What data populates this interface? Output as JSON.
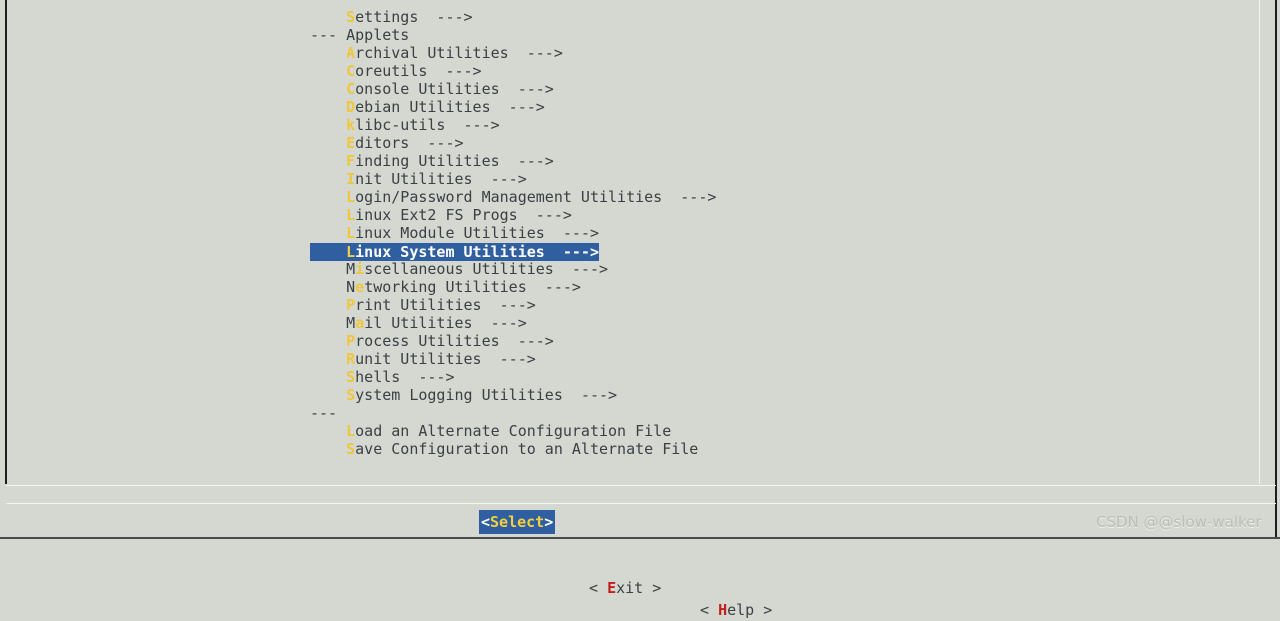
{
  "app": {
    "kind": "ncurses-menuconfig",
    "background_color": "#d4d8d0",
    "text_color": "#3b4044",
    "hotkey_color": "#f0c63c",
    "highlight_bg": "#2f5fa0",
    "highlight_fg": "#ffffff",
    "button_accent_color": "#c0201c"
  },
  "menu": {
    "items": [
      {
        "indent": 4,
        "hot_index": 0,
        "label": "Settings  --->",
        "selected": false,
        "type": "submenu"
      },
      {
        "indent": 0,
        "hot_index": -1,
        "label": "--- Applets",
        "selected": false,
        "type": "separator-label"
      },
      {
        "indent": 4,
        "hot_index": 0,
        "label": "Archival Utilities  --->",
        "selected": false,
        "type": "submenu"
      },
      {
        "indent": 4,
        "hot_index": 0,
        "label": "Coreutils  --->",
        "selected": false,
        "type": "submenu"
      },
      {
        "indent": 4,
        "hot_index": 0,
        "label": "Console Utilities  --->",
        "selected": false,
        "type": "submenu"
      },
      {
        "indent": 4,
        "hot_index": 0,
        "label": "Debian Utilities  --->",
        "selected": false,
        "type": "submenu"
      },
      {
        "indent": 4,
        "hot_index": 0,
        "label": "klibc-utils  --->",
        "selected": false,
        "type": "submenu"
      },
      {
        "indent": 4,
        "hot_index": 0,
        "label": "Editors  --->",
        "selected": false,
        "type": "submenu"
      },
      {
        "indent": 4,
        "hot_index": 0,
        "label": "Finding Utilities  --->",
        "selected": false,
        "type": "submenu"
      },
      {
        "indent": 4,
        "hot_index": 0,
        "label": "Init Utilities  --->",
        "selected": false,
        "type": "submenu"
      },
      {
        "indent": 4,
        "hot_index": 0,
        "label": "Login/Password Management Utilities  --->",
        "selected": false,
        "type": "submenu"
      },
      {
        "indent": 4,
        "hot_index": 0,
        "label": "Linux Ext2 FS Progs  --->",
        "selected": false,
        "type": "submenu"
      },
      {
        "indent": 4,
        "hot_index": 0,
        "label": "Linux Module Utilities  --->",
        "selected": false,
        "type": "submenu"
      },
      {
        "indent": 4,
        "hot_index": 0,
        "label": "Linux System Utilities  --->",
        "selected": true,
        "type": "submenu"
      },
      {
        "indent": 4,
        "hot_index": 1,
        "label": "Miscellaneous Utilities  --->",
        "selected": false,
        "type": "submenu"
      },
      {
        "indent": 4,
        "hot_index": 1,
        "label": "Networking Utilities  --->",
        "selected": false,
        "type": "submenu"
      },
      {
        "indent": 4,
        "hot_index": 0,
        "label": "Print Utilities  --->",
        "selected": false,
        "type": "submenu"
      },
      {
        "indent": 4,
        "hot_index": 1,
        "label": "Mail Utilities  --->",
        "selected": false,
        "type": "submenu"
      },
      {
        "indent": 4,
        "hot_index": 0,
        "label": "Process Utilities  --->",
        "selected": false,
        "type": "submenu"
      },
      {
        "indent": 4,
        "hot_index": 0,
        "label": "Runit Utilities  --->",
        "selected": false,
        "type": "submenu"
      },
      {
        "indent": 4,
        "hot_index": 0,
        "label": "Shells  --->",
        "selected": false,
        "type": "submenu"
      },
      {
        "indent": 4,
        "hot_index": 0,
        "label": "System Logging Utilities  --->",
        "selected": false,
        "type": "submenu"
      },
      {
        "indent": 0,
        "hot_index": -1,
        "label": "---",
        "selected": false,
        "type": "separator"
      },
      {
        "indent": 4,
        "hot_index": 0,
        "label": "Load an Alternate Configuration File",
        "selected": false,
        "type": "action"
      },
      {
        "indent": 4,
        "hot_index": 0,
        "label": "Save Configuration to an Alternate File",
        "selected": false,
        "type": "action"
      }
    ]
  },
  "buttons": {
    "select": {
      "prefix": "<",
      "label": "Select",
      "suffix": ">",
      "active": true
    },
    "exit": {
      "prefix": "< ",
      "hot": "E",
      "rest": "xit",
      "suffix": " >",
      "active": false
    },
    "help": {
      "prefix": "< ",
      "hot": "H",
      "rest": "elp",
      "suffix": " >",
      "active": false
    }
  },
  "watermark": {
    "text": "CSDN @@slow-walker"
  }
}
